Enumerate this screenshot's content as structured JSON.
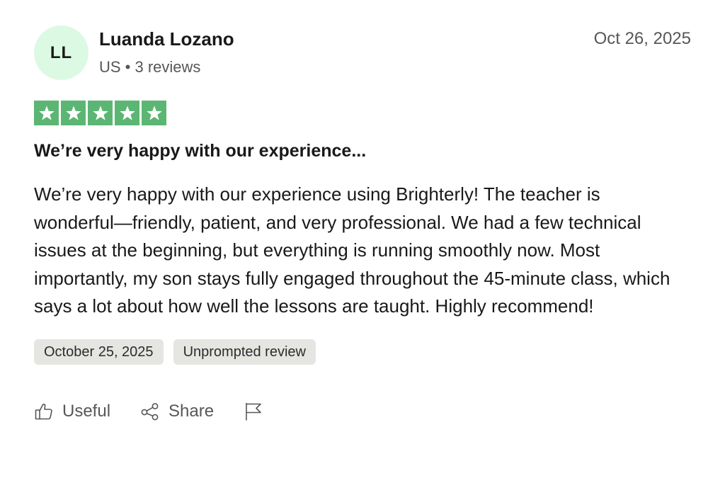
{
  "consumer": {
    "initials": "LL",
    "name": "Luanda Lozano",
    "meta": "US • 3 reviews"
  },
  "review": {
    "date": "Oct 26, 2025",
    "rating": 5,
    "max_rating": 5,
    "title": "We’re very happy with our experience...",
    "body": "We’re very happy with our experience using Brighterly! The teacher is wonderful—friendly, patient, and very professional. We had a few technical issues at the beginning, but everything is running smoothly now. Most importantly, my son stays fully engaged throughout the 45-minute class, which says a lot about how well the lessons are taught. Highly recommend!"
  },
  "tags": [
    {
      "label": "October 25, 2025"
    },
    {
      "label": "Unprompted review"
    }
  ],
  "actions": {
    "useful_label": "Useful",
    "share_label": "Share"
  },
  "colors": {
    "star_fill": "#5bb673",
    "avatar_bg": "#dcf9e3",
    "tag_bg": "#e5e5e2"
  },
  "icons": {
    "useful": "thumbs-up-icon",
    "share": "share-icon",
    "flag": "flag-icon",
    "star": "star-icon"
  }
}
